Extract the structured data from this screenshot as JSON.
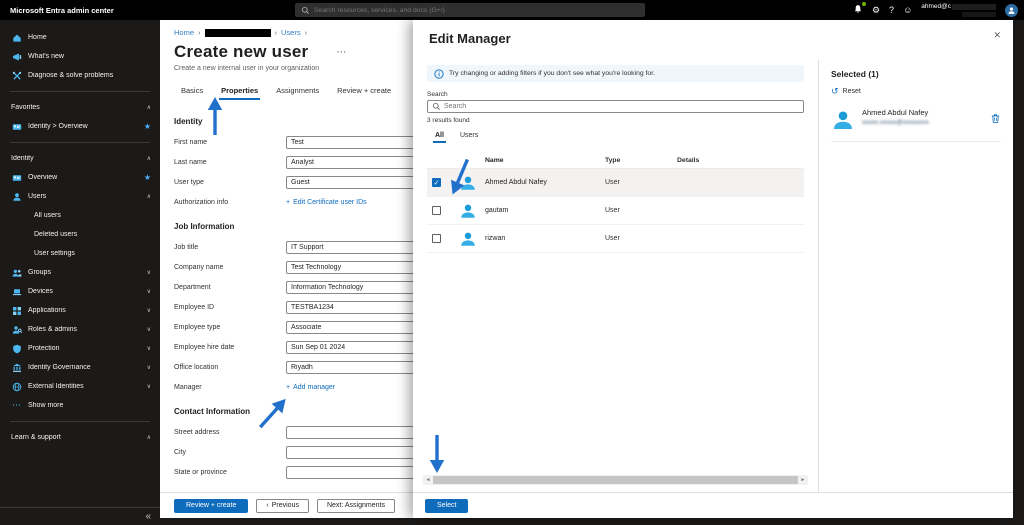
{
  "topbar": {
    "title": "Microsoft Entra admin center",
    "search_placeholder": "Search resources, services, and docs (G+/)",
    "user_email": "ahmed@c"
  },
  "sidebar": {
    "items": [
      {
        "label": "Home"
      },
      {
        "label": "What's new"
      },
      {
        "label": "Diagnose & solve problems"
      },
      {
        "label": "Favorites"
      },
      {
        "label": "Identity > Overview"
      },
      {
        "label": "Identity"
      },
      {
        "label": "Overview"
      },
      {
        "label": "Users"
      },
      {
        "label": "All users"
      },
      {
        "label": "Deleted users"
      },
      {
        "label": "User settings"
      },
      {
        "label": "Groups"
      },
      {
        "label": "Devices"
      },
      {
        "label": "Applications"
      },
      {
        "label": "Roles & admins"
      },
      {
        "label": "Protection"
      },
      {
        "label": "Identity Governance"
      },
      {
        "label": "External Identities"
      },
      {
        "label": "Show more"
      },
      {
        "label": "Learn & support"
      }
    ]
  },
  "breadcrumb": {
    "home": "Home",
    "users": "Users"
  },
  "page": {
    "title": "Create new user",
    "subtitle": "Create a new internal user in your organization",
    "tabs": [
      "Basics",
      "Properties",
      "Assignments",
      "Review + create"
    ],
    "active_tab": "Properties"
  },
  "form": {
    "sections": [
      {
        "title": "Identity",
        "rows": [
          {
            "label": "First name",
            "value": "Test"
          },
          {
            "label": "Last name",
            "value": "Analyst"
          },
          {
            "label": "User type",
            "value": "Guest"
          },
          {
            "label": "Authorization info",
            "link": "Edit Certificate user IDs"
          }
        ]
      },
      {
        "title": "Job Information",
        "rows": [
          {
            "label": "Job title",
            "value": "IT Support"
          },
          {
            "label": "Company name",
            "value": "Test Technology"
          },
          {
            "label": "Department",
            "value": "Information Technology"
          },
          {
            "label": "Employee ID",
            "value": "TESTBA1234"
          },
          {
            "label": "Employee type",
            "value": "Associate"
          },
          {
            "label": "Employee hire date",
            "value": "Sun Sep 01 2024"
          },
          {
            "label": "Office location",
            "value": "Riyadh"
          },
          {
            "label": "Manager",
            "link": "Add manager"
          }
        ]
      },
      {
        "title": "Contact Information",
        "rows": [
          {
            "label": "Street address",
            "value": ""
          },
          {
            "label": "City",
            "value": ""
          },
          {
            "label": "State or province",
            "value": ""
          }
        ]
      }
    ]
  },
  "footer": {
    "review_create": "Review + create",
    "previous": "Previous",
    "next": "Next: Assignments"
  },
  "panel": {
    "title": "Edit Manager",
    "info": "Try changing or adding filters if you don't see what you're looking for.",
    "search_label": "Search",
    "search_placeholder": "Search",
    "results": "3 results found",
    "tabs": [
      "All",
      "Users"
    ],
    "columns": [
      "Name",
      "Type",
      "Details"
    ],
    "rows": [
      {
        "name": "Ahmed Abdul Nafey",
        "type": "User"
      },
      {
        "name": "gautam",
        "type": "User"
      },
      {
        "name": "rizwan",
        "type": "User"
      }
    ],
    "select_button": "Select"
  },
  "selected_panel": {
    "title": "Selected (1)",
    "reset": "Reset",
    "item": {
      "name": "Ahmed Abdul Nafey",
      "email_masked": "xxxxx.xxxxx@xxxxxxxx"
    }
  },
  "icons": {
    "gear": "⚙",
    "help": "?",
    "smiley": "☺",
    "chevron_up": "∧",
    "chevron_down": "∨",
    "star": "★",
    "ellipsis": "⋯",
    "collapse": "«",
    "close": "✕",
    "check": "✓",
    "reset": "↺",
    "plus": "+",
    "crumb_sep": "›",
    "scroll_left": "◄",
    "scroll_right": "►",
    "previous_chevron": "‹"
  },
  "colors": {
    "accent": "#0f6cbd",
    "annotation_arrow": "#2170cc",
    "selected_row": "#f3f2f1",
    "info_banner": "#eff6fc",
    "topbar": "#000000",
    "sidebar": "#1b1a19"
  }
}
